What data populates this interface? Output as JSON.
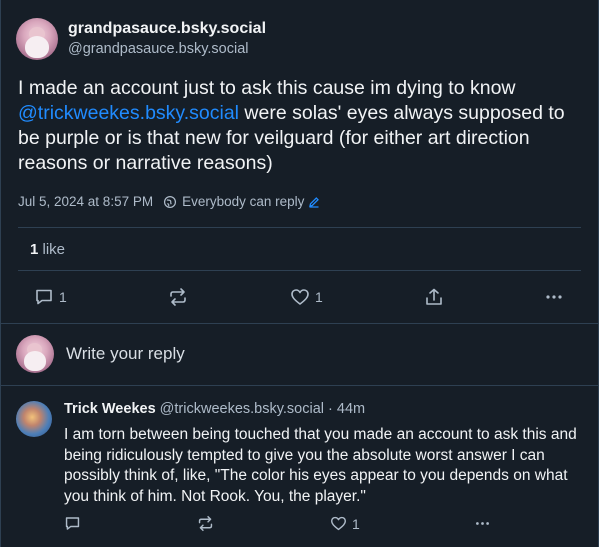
{
  "post": {
    "display_name": "grandpasauce.bsky.social",
    "handle": "@grandpasauce.bsky.social",
    "text_before": "I made an account just to ask this cause im dying to know ",
    "mention": "@trickweekes.bsky.social",
    "text_after": " were solas' eyes always supposed to be purple or is that new for veilguard (for either art direction reasons or narrative reasons)",
    "timestamp": "Jul 5, 2024 at 8:57 PM",
    "reply_setting": "Everybody can reply",
    "like_count": "1",
    "like_label": "like",
    "actions": {
      "reply_count": "1",
      "like_count": "1"
    }
  },
  "composer": {
    "placeholder": "Write your reply"
  },
  "reply": {
    "display_name": "Trick Weekes",
    "handle": "@trickweekes.bsky.social",
    "age": "44m",
    "text": "I am torn between being touched that you made an account to ask this and being ridiculously tempted to give you the absolute worst answer I can possibly think of, like, \"The color his eyes appear to you depends on what you think of him. Not Rook. You, the player.\"",
    "actions": {
      "like_count": "1"
    }
  },
  "colors": {
    "background": "#161e27",
    "accent": "#208bfe",
    "muted": "#aebbc9",
    "divider": "#2e4052"
  }
}
